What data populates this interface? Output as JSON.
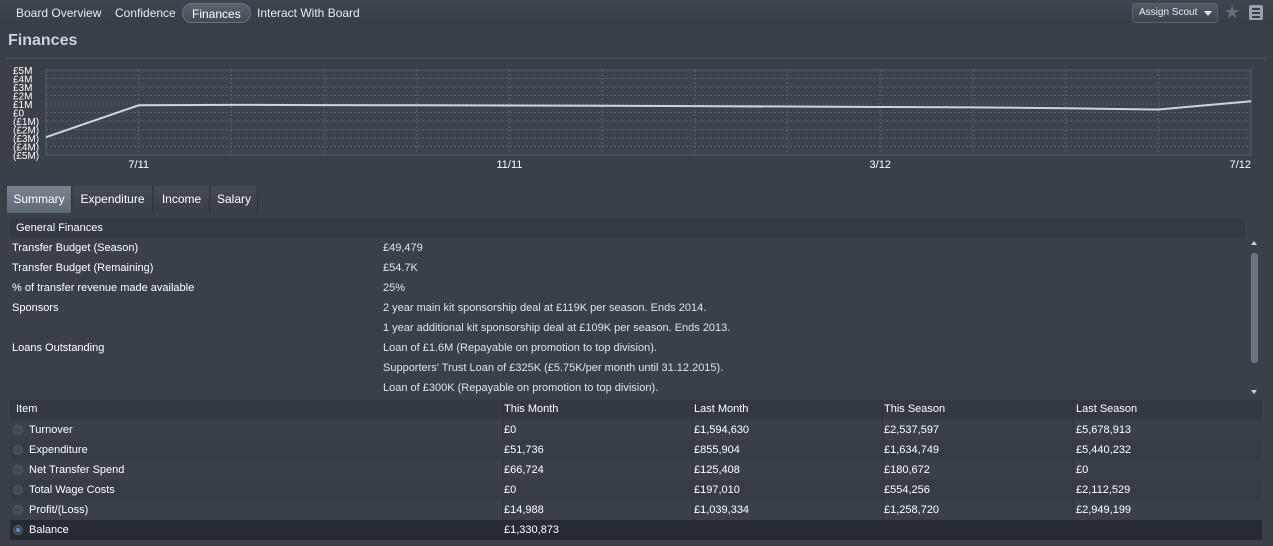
{
  "nav": {
    "tabs": [
      {
        "label": "Board Overview",
        "active": false
      },
      {
        "label": "Confidence",
        "active": false
      },
      {
        "label": "Finances",
        "active": true
      },
      {
        "label": "Interact With Board",
        "active": false
      }
    ],
    "assign_scout_label": "Assign Scout",
    "icons": [
      "star-icon",
      "notes-icon",
      "chevron-down-icon"
    ]
  },
  "page": {
    "title": "Finances"
  },
  "chart_data": {
    "type": "line",
    "y_ticks": [
      "£5M",
      "£4M",
      "£3M",
      "£2M",
      "£1M",
      "£0",
      "(£1M)",
      "(£2M)",
      "(£3M)",
      "(£4M)",
      "(£5M)"
    ],
    "ylim": [
      -5,
      5
    ],
    "x_ticks": [
      "7/11",
      "11/11",
      "3/12",
      "7/12"
    ],
    "series": [
      {
        "color": "#c9d6ea",
        "x": [
          "6/11",
          "7/11",
          "8/11",
          "9/11",
          "10/11",
          "11/11",
          "12/11",
          "1/12",
          "2/12",
          "3/12",
          "4/12",
          "5/12",
          "6/12",
          "7/12"
        ],
        "values": [
          -2.9,
          0.85,
          0.9,
          0.87,
          0.85,
          0.82,
          0.8,
          0.75,
          0.7,
          0.65,
          0.6,
          0.5,
          0.35,
          1.33
        ]
      }
    ]
  },
  "subtabs": [
    {
      "label": "Summary",
      "active": true
    },
    {
      "label": "Expenditure",
      "active": false
    },
    {
      "label": "Income",
      "active": false
    },
    {
      "label": "Salary",
      "active": false
    }
  ],
  "general_finances": {
    "header": "General Finances",
    "rows": [
      {
        "label": "Transfer Budget (Season)",
        "value": "£49,479"
      },
      {
        "label": "Transfer Budget (Remaining)",
        "value": "£54.7K"
      },
      {
        "label": "% of transfer revenue made available",
        "value": "25%"
      },
      {
        "label": "Sponsors",
        "value": "2 year main kit sponsorship deal at £119K per season. Ends 2014."
      },
      {
        "label": "",
        "value": "1 year additional kit sponsorship deal at £109K per season. Ends 2013."
      },
      {
        "label": "Loans Outstanding",
        "value": "Loan of £1.6M (Repayable on promotion to top division)."
      },
      {
        "label": "",
        "value": "Supporters' Trust Loan of £325K (£5.75K/per month until 31.12.2015)."
      },
      {
        "label": "",
        "value": "Loan of £300K (Repayable on promotion to top division)."
      }
    ]
  },
  "finance_table": {
    "columns": [
      "Item",
      "This Month",
      "Last Month",
      "This Season",
      "Last Season"
    ],
    "rows": [
      {
        "item": "Turnover",
        "this_month": "£0",
        "last_month": "£1,594,630",
        "this_season": "£2,537,597",
        "last_season": "£5,678,913"
      },
      {
        "item": "Expenditure",
        "this_month": "£51,736",
        "last_month": "£855,904",
        "this_season": "£1,634,749",
        "last_season": "£5,440,232"
      },
      {
        "item": "Net Transfer Spend",
        "this_month": "£66,724",
        "last_month": "£125,408",
        "this_season": "£180,672",
        "last_season": "£0"
      },
      {
        "item": "Total Wage Costs",
        "this_month": "£0",
        "last_month": "£197,010",
        "this_season": "£554,256",
        "last_season": "£2,112,529"
      },
      {
        "item": "Profit/(Loss)",
        "this_month": "£14,988",
        "last_month": "£1,039,334",
        "this_season": "£1,258,720",
        "last_season": "£2,949,199"
      }
    ],
    "balance": {
      "item": "Balance",
      "this_month": "£1,330,873"
    }
  }
}
